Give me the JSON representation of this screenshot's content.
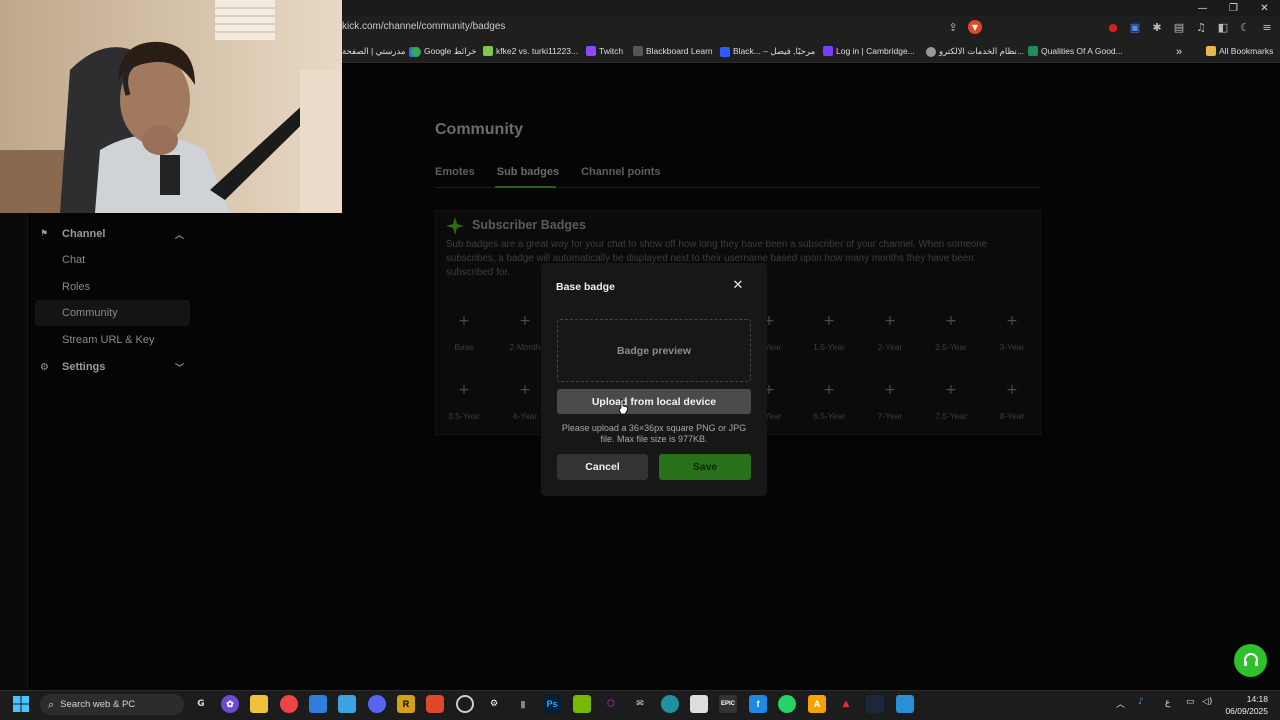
{
  "browser": {
    "url": "kick.com/channel/community/badges",
    "bookmarks": [
      {
        "label": "مدرستي | الصفحة",
        "color": "#2f6ae0"
      },
      {
        "label": "Google خرائط",
        "color": "#34a853"
      },
      {
        "label": "kfke2 vs. turki11223...",
        "color": "#7ec850"
      },
      {
        "label": "Twitch",
        "color": "#9146ff"
      },
      {
        "label": "Blackboard Learn",
        "color": "#333333"
      },
      {
        "label": "Black... – مرحبًا, فيصل",
        "color": "#2e5dff"
      },
      {
        "label": "Log in | Cambridge...",
        "color": "#7b3cff"
      },
      {
        "label": "نظام الخدمات الالكترو...",
        "color": "#999999"
      },
      {
        "label": "Qualities Of A Good...",
        "color": "#1a8f5a"
      }
    ],
    "overflow": "»",
    "all_bookmarks": "All Bookmarks",
    "window_controls": [
      "—",
      "❐",
      "✕"
    ]
  },
  "sidebar": {
    "channel_label": "Channel",
    "items": [
      "Chat",
      "Roles",
      "Community",
      "Stream URL & Key"
    ],
    "settings_label": "Settings",
    "active": "Community"
  },
  "main": {
    "title": "Community",
    "tabs": [
      "Emotes",
      "Sub badges",
      "Channel points"
    ],
    "active_tab": "Sub badges",
    "card": {
      "title": "Subscriber Badges",
      "description": "Sub badges are a great way for your chat to show off how long they have been a subscriber of your channel. When someone subscribes, a badge will automatically be displayed next to their username based upon how many months they have been subscribed for.",
      "row1": [
        "Base",
        "2-Month",
        "",
        "",
        "",
        "1-Year",
        "1.5-Year",
        "2-Year",
        "2.5-Year",
        "3-Year"
      ],
      "row2": [
        "3.5-Year",
        "4-Year",
        "",
        "",
        "",
        "6-Year",
        "6.5-Year",
        "7-Year",
        "7.5-Year",
        "8-Year"
      ]
    }
  },
  "modal": {
    "title": "Base badge",
    "preview": "Badge preview",
    "upload": "Upload from local device",
    "hint": "Please upload a 36×36px square PNG or JPG file. Max file size is 977KB.",
    "cancel": "Cancel",
    "save": "Save"
  },
  "taskbar": {
    "search": "Search web & PC",
    "time": "14:18",
    "date": "06/09/2025",
    "lang": "ع"
  },
  "colors": {
    "accent_green": "#53fc18",
    "save_green": "#27711a"
  }
}
